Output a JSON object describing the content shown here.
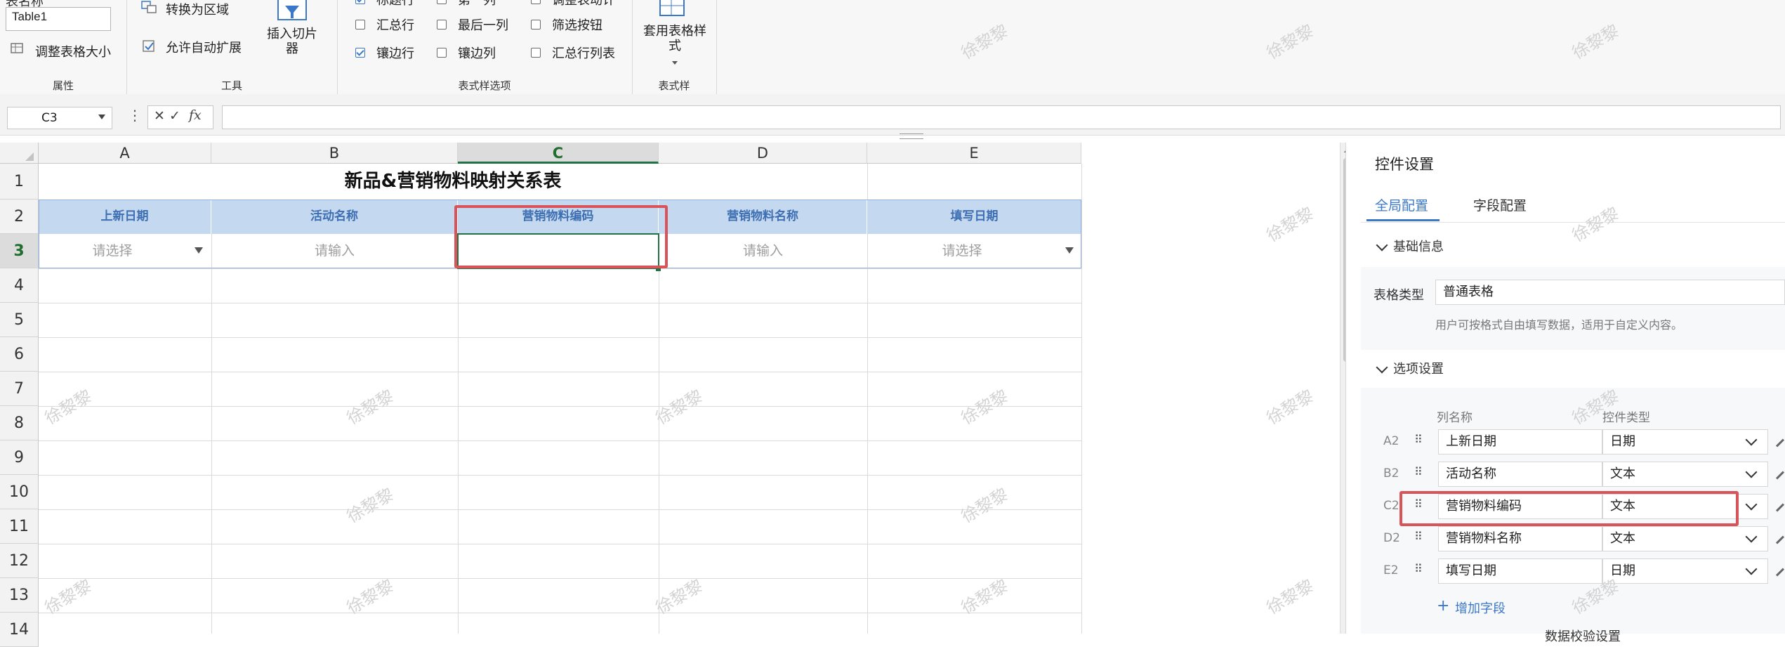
{
  "ribbon": {
    "table_name_partial": "表名称",
    "table_name_value": "Table1",
    "resize_table": "调整表格大小",
    "group_properties": "属性",
    "convert_to_range": "转换为区域",
    "allow_auto_expand": "允许自动扩展",
    "insert_slicer": "插入切片器",
    "group_tools": "工具",
    "header_row_partial": "标题行",
    "total_row": "汇总行",
    "banded_rows": "镶边行",
    "first_column_partial": "第一列",
    "last_column": "最后一列",
    "banded_columns": "镶边列",
    "reorder_partial": "调整表动计",
    "filter_button": "筛选按钮",
    "total_row_list": "汇总行列表",
    "group_style_options": "表式样选项",
    "apply_table_style": "套用表格样式",
    "group_table_style": "表式样"
  },
  "formula_bar": {
    "name_box": "C3",
    "cancel_symbol": "✕",
    "confirm_symbol": "✓",
    "fx_symbol": "fx",
    "formula": ""
  },
  "grid": {
    "columns": [
      "A",
      "B",
      "C",
      "D",
      "E"
    ],
    "active_column": "C",
    "rows": [
      "1",
      "2",
      "3",
      "4",
      "5",
      "6",
      "7",
      "8",
      "9",
      "10",
      "11",
      "12",
      "13",
      "14"
    ],
    "active_row": "3",
    "title": "新品&营销物料映射关系表",
    "headers": [
      "上新日期",
      "活动名称",
      "营销物料编码",
      "营销物料名称",
      "填写日期"
    ],
    "row3": [
      "请选择",
      "请输入",
      "",
      "请输入",
      "请选择"
    ]
  },
  "panel": {
    "title": "控件设置",
    "tabs": [
      "全局配置",
      "字段配置"
    ],
    "active_tab": "全局配置",
    "section_basic": "基础信息",
    "table_type_label": "表格类型",
    "table_type_value": "普通表格",
    "table_type_desc": "用户可按格式自由填写数据，适用于自定义内容。",
    "section_options": "选项设置",
    "col_name_header": "列名称",
    "control_type_header": "控件类型",
    "fields": [
      {
        "cell": "A2",
        "name": "上新日期",
        "type": "日期"
      },
      {
        "cell": "B2",
        "name": "活动名称",
        "type": "文本"
      },
      {
        "cell": "C2",
        "name": "营销物料编码",
        "type": "文本"
      },
      {
        "cell": "D2",
        "name": "营销物料名称",
        "type": "文本"
      },
      {
        "cell": "E2",
        "name": "填写日期",
        "type": "日期"
      }
    ],
    "add_field": "增加字段",
    "bottom_partial": "数据校验设置"
  },
  "watermark": "徐黎黎",
  "colors": {
    "header_fill": "#c4d8ef",
    "header_text": "#3e6fb3",
    "accent_blue": "#3c78c8",
    "highlight_red": "#d9535a",
    "active_green": "#217346"
  }
}
